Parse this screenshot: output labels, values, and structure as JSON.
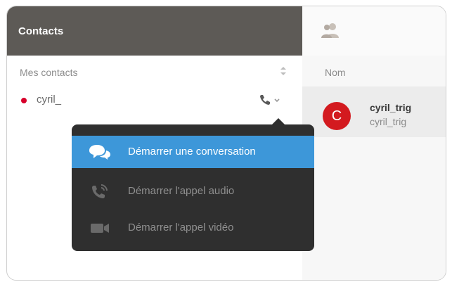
{
  "left": {
    "title": "Contacts",
    "group_label": "Mes contacts",
    "contact": {
      "name": "cyril_",
      "presence_color": "#d7002a"
    }
  },
  "right": {
    "column_label": "Nom",
    "result": {
      "avatar_letter": "C",
      "name": "cyril_trig",
      "subtitle": "cyril_trig"
    }
  },
  "menu": {
    "items": [
      {
        "label": "Démarrer une conversation",
        "icon": "chat-bubbles-icon"
      },
      {
        "label": "Démarrer l'appel audio",
        "icon": "phone-icon"
      },
      {
        "label": "Démarrer l'appel vidéo",
        "icon": "video-camera-icon"
      }
    ],
    "accent": "#3d97d9"
  }
}
